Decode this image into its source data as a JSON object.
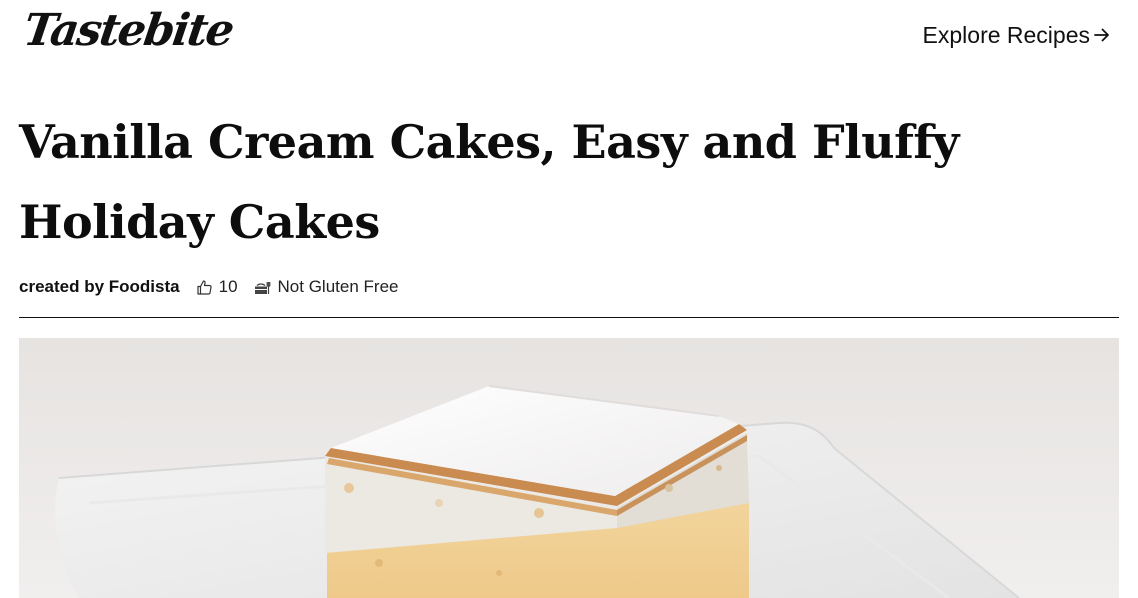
{
  "header": {
    "logo_text": "Tastebite",
    "explore_label": "Explore Recipes"
  },
  "recipe": {
    "title": "Vanilla Cream Cakes, Easy and Fluffy Holiday Cakes",
    "author_label": "created by Foodista",
    "likes": "10",
    "diet_label": "Not Gluten Free"
  },
  "icons": {
    "explore": "arrow-right-icon",
    "likes": "thumbs-up-icon",
    "diet": "food-icon"
  },
  "colors": {
    "text": "#111111",
    "background": "#ffffff",
    "divider": "#111111"
  }
}
